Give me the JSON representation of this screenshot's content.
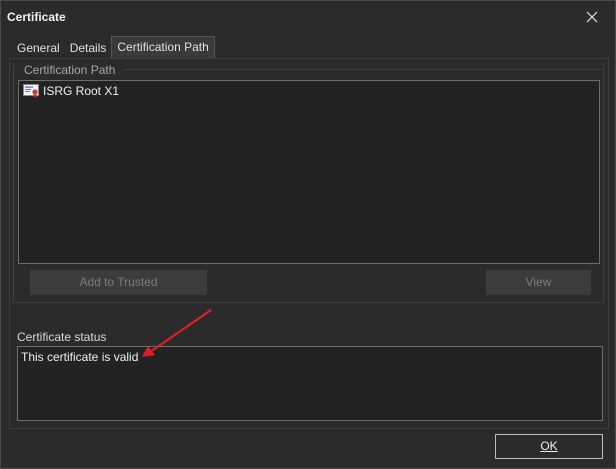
{
  "window": {
    "title": "Certificate",
    "close_glyph": "✕"
  },
  "tabs": [
    {
      "label": "General",
      "active": false
    },
    {
      "label": "Details",
      "active": false
    },
    {
      "label": "Certification Path",
      "active": true
    }
  ],
  "certification_path": {
    "group_label": "Certification Path",
    "items": [
      {
        "label": "ISRG Root X1",
        "icon": "certificate-icon"
      }
    ],
    "add_to_trusted_label": "Add to Trusted",
    "view_label": "View"
  },
  "status": {
    "label": "Certificate status",
    "text": "This certificate is valid"
  },
  "buttons": {
    "ok_label": "OK"
  },
  "colors": {
    "background": "#2b2b2b",
    "field_background": "#232323",
    "annotation_arrow": "#e02020"
  }
}
